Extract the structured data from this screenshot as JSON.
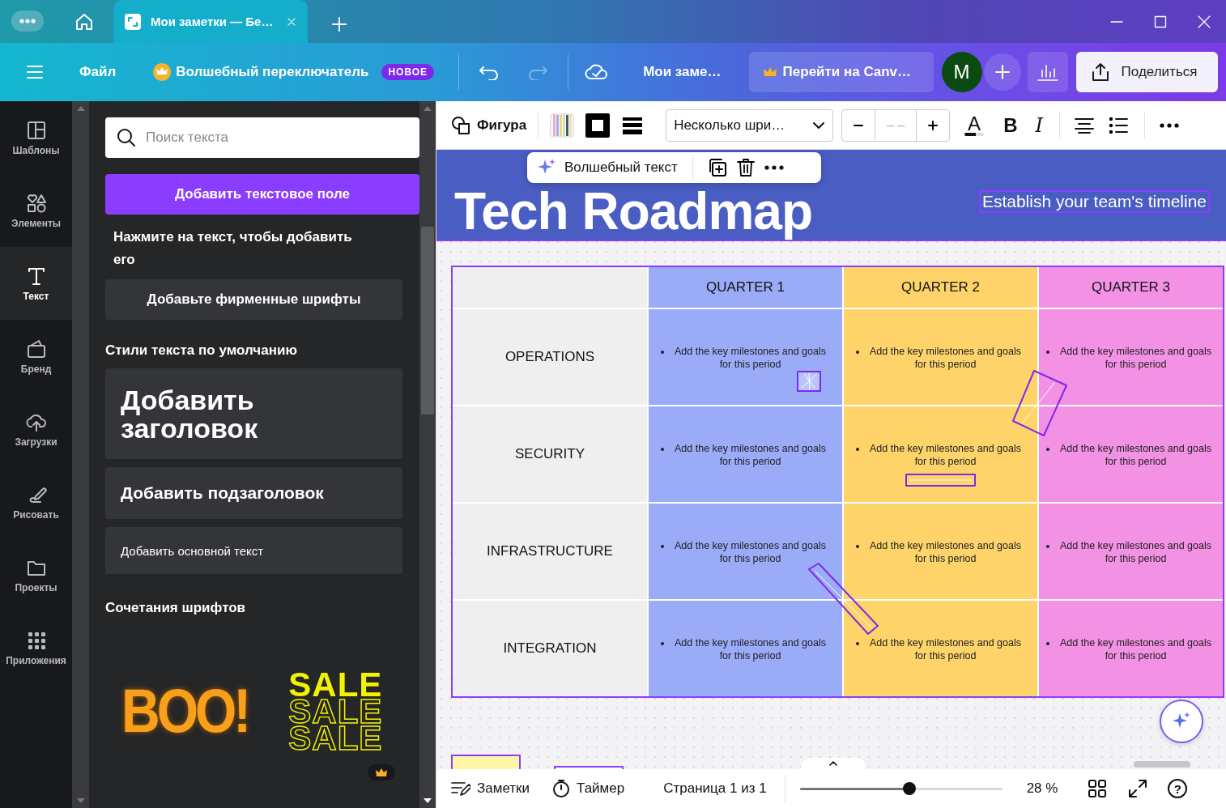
{
  "titlebar": {
    "tab": {
      "title": "Мои заметки — Бе…",
      "selected": true
    }
  },
  "menubar": {
    "file": "Файл",
    "magic_switch": "Волшебный переключатель",
    "badge": "НОВОЕ",
    "undo": {
      "disabled": false
    },
    "redo": {
      "disabled": true
    },
    "doc_title": "Мои заме…",
    "upgrade": "Перейти на Canv…",
    "avatar": "M",
    "share": "Поделиться"
  },
  "sidebar": {
    "items": [
      {
        "label": "Шаблоны",
        "selected": false
      },
      {
        "label": "Элементы",
        "selected": false
      },
      {
        "label": "Текст",
        "selected": true
      },
      {
        "label": "Бренд",
        "selected": false
      },
      {
        "label": "Загрузки",
        "selected": false
      },
      {
        "label": "Рисовать",
        "selected": false
      },
      {
        "label": "Проекты",
        "selected": false
      },
      {
        "label": "Приложения",
        "selected": false
      }
    ]
  },
  "panel": {
    "search": {
      "placeholder": "Поиск текста"
    },
    "add_textbox": "Добавить текстовое поле",
    "hint": "Нажмите на текст, чтобы добавить его",
    "brand_fonts": "Добавьте фирменные шрифты",
    "default_styles": {
      "title": "Стили текста по умолчанию",
      "items": [
        {
          "kind": "heading",
          "label": "Добавить заголовок"
        },
        {
          "kind": "subheading",
          "label": "Добавить подзаголовок"
        },
        {
          "kind": "body",
          "label": "Добавить основной текст"
        }
      ]
    },
    "font_combos": {
      "title": "Сочетания шрифтов",
      "items": [
        {
          "kind": "spooky",
          "lines": [
            "BOO!"
          ]
        },
        {
          "kind": "outline",
          "lines": [
            "SALE",
            "SALE",
            "SALE"
          ],
          "premium": true
        }
      ]
    }
  },
  "toolbar": {
    "shape": "Фигура",
    "font": "Несколько шри…",
    "font_size": "– –",
    "text_color": "A",
    "bold": "B",
    "italic": "I"
  },
  "floating_toolbar": {
    "magic_text": "Волшебный текст"
  },
  "design": {
    "title": "Tech Roadmap",
    "subtitle": "Establish your team's timeline",
    "table": {
      "columns": [
        {
          "label": "QUARTER 1",
          "color": "#9aabf8"
        },
        {
          "label": "QUARTER 2",
          "color": "#fdd36a"
        },
        {
          "label": "QUARTER 3",
          "color": "#f391e5"
        }
      ],
      "rows": [
        {
          "label": "OPERATIONS",
          "cells": [
            "Add the key milestones and goals for this period",
            "Add the key milestones and goals for this period",
            "Add the key milestones and goals for this period"
          ]
        },
        {
          "label": "SECURITY",
          "cells": [
            "Add the key milestones and goals for this period",
            "Add the key milestones and goals for this period",
            "Add the key milestones and goals for this period"
          ]
        },
        {
          "label": "INFRASTRUCTURE",
          "cells": [
            "Add the key milestones and goals for this period",
            "Add the key milestones and goals for this period",
            "Add the key milestones and goals for this period"
          ]
        },
        {
          "label": "INTEGRATION",
          "cells": [
            "Add the key milestones and goals for this period",
            "Add the key milestones and goals for this period",
            "Add the key milestones and goals for this period"
          ]
        }
      ]
    }
  },
  "bottom_bar": {
    "notes": "Заметки",
    "timer": "Таймер",
    "page": "Страница 1 из 1",
    "zoom": {
      "level": 0.54,
      "reading": "28 %"
    },
    "help": "?"
  }
}
